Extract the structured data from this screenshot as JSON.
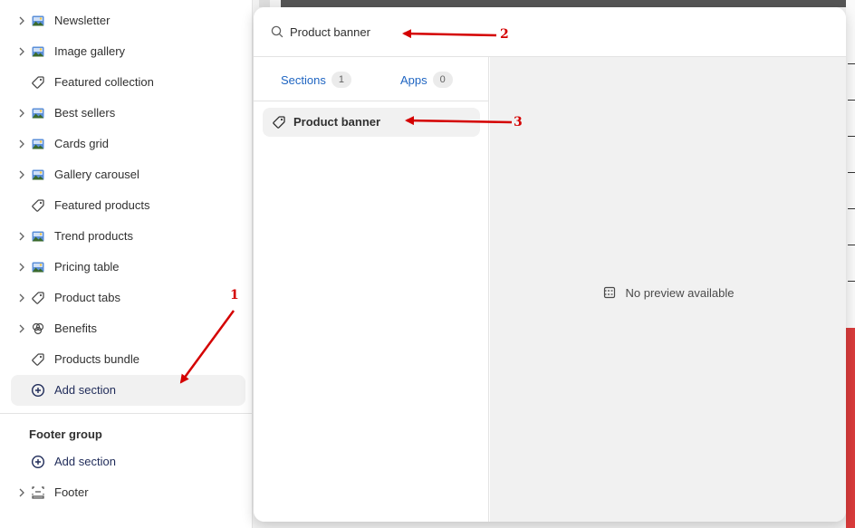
{
  "sidebar": {
    "items": [
      {
        "label": "Newsletter",
        "icon": "image-thumb-icon",
        "chevron": true
      },
      {
        "label": "Image gallery",
        "icon": "image-thumb-icon",
        "chevron": true
      },
      {
        "label": "Featured collection",
        "icon": "tag-icon",
        "chevron": false
      },
      {
        "label": "Best sellers",
        "icon": "image-thumb-icon",
        "chevron": true
      },
      {
        "label": "Cards grid",
        "icon": "image-thumb-icon",
        "chevron": true
      },
      {
        "label": "Gallery carousel",
        "icon": "image-thumb-icon",
        "chevron": true
      },
      {
        "label": "Featured products",
        "icon": "tag-icon",
        "chevron": false
      },
      {
        "label": "Trend products",
        "icon": "image-thumb-icon",
        "chevron": true
      },
      {
        "label": "Pricing table",
        "icon": "image-thumb-icon",
        "chevron": true
      },
      {
        "label": "Product tabs",
        "icon": "tag-icon",
        "chevron": true
      },
      {
        "label": "Benefits",
        "icon": "benefits-icon",
        "chevron": true
      },
      {
        "label": "Products bundle",
        "icon": "tag-icon",
        "chevron": false
      }
    ],
    "add_section_label": "Add section",
    "footer_group_title": "Footer group",
    "footer_add_section_label": "Add section",
    "footer_item_label": "Footer"
  },
  "popover": {
    "search_value": "Product banner",
    "tabs": {
      "sections_label": "Sections",
      "sections_count": "1",
      "apps_label": "Apps",
      "apps_count": "0"
    },
    "result_label": "Product banner",
    "no_preview_text": "No preview available"
  },
  "annotations": {
    "one": "1",
    "two": "2",
    "three": "3"
  },
  "colors": {
    "accent_link": "#1f65c2",
    "annotation": "#d40000",
    "selected_bg": "#f1f1f1"
  }
}
